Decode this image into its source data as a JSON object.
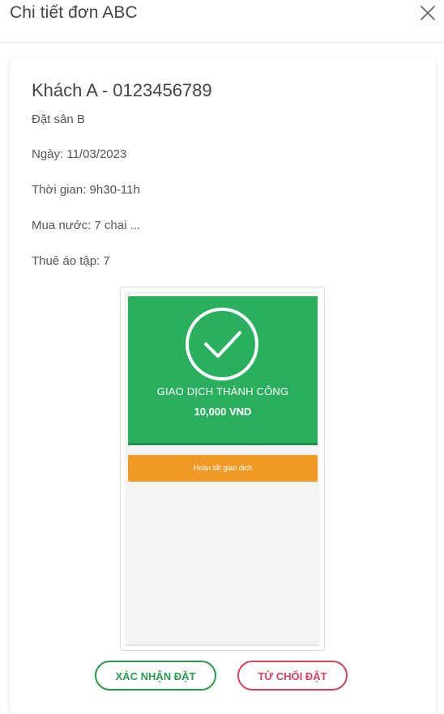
{
  "header": {
    "title": "Chi tiết đơn ABC",
    "close_icon": "close-icon"
  },
  "order": {
    "customer": "Khách A - 0123456789",
    "venue": "Đặt sân B",
    "date": "Ngày: 11/03/2023",
    "time": "Thời gian: 9h30-11h",
    "drinks": "Mua nước: 7 chai ...",
    "shirts": "Thuê áo tập: 7"
  },
  "receipt": {
    "status_icon": "check-circle-icon",
    "status": "GIAO DỊCH THÀNH CÔNG",
    "amount": "10,000 VND",
    "finish_label": "Hoàn tất giao dịch",
    "colors": {
      "success": "#2aaf5f",
      "finish": "#ef9a25"
    }
  },
  "actions": {
    "confirm_label": "XÁC NHẬN ĐẶT",
    "reject_label": "TỪ CHỐI ĐẶT",
    "colors": {
      "confirm": "#2a9a4f",
      "reject": "#d9405a"
    }
  }
}
